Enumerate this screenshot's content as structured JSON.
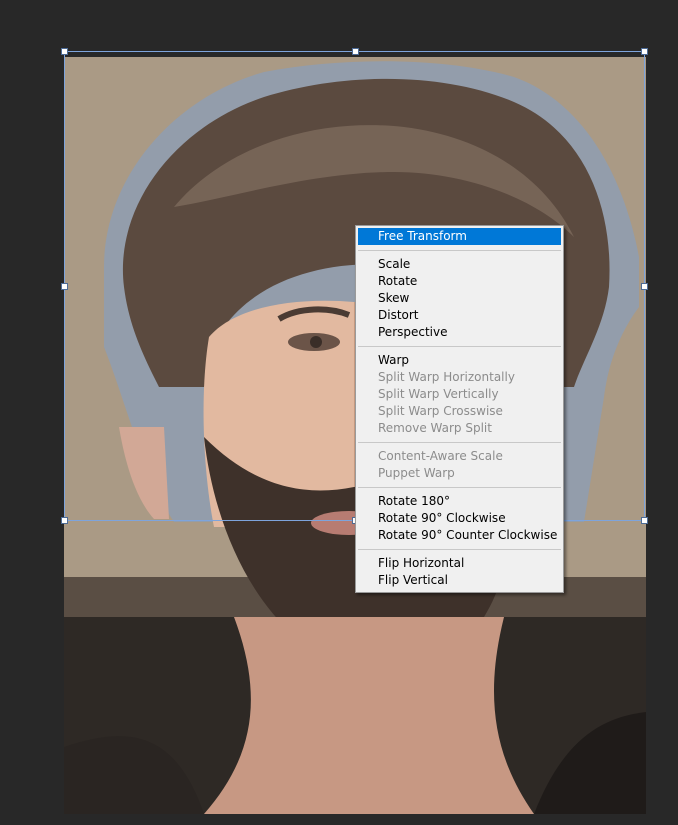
{
  "canvas": {
    "image_subject": "bearded-man-portrait-photo"
  },
  "transform_box": {
    "handle_color": "#ffffff",
    "border_color": "#7ea4dc"
  },
  "context_menu": {
    "highlight_color": "#0078d7",
    "groups": [
      [
        {
          "label": "Free Transform",
          "state": "highlighted"
        }
      ],
      [
        {
          "label": "Scale",
          "state": "enabled"
        },
        {
          "label": "Rotate",
          "state": "enabled"
        },
        {
          "label": "Skew",
          "state": "enabled"
        },
        {
          "label": "Distort",
          "state": "enabled"
        },
        {
          "label": "Perspective",
          "state": "enabled"
        }
      ],
      [
        {
          "label": "Warp",
          "state": "enabled"
        },
        {
          "label": "Split Warp Horizontally",
          "state": "disabled"
        },
        {
          "label": "Split Warp Vertically",
          "state": "disabled"
        },
        {
          "label": "Split Warp Crosswise",
          "state": "disabled"
        },
        {
          "label": "Remove Warp Split",
          "state": "disabled"
        }
      ],
      [
        {
          "label": "Content-Aware Scale",
          "state": "disabled"
        },
        {
          "label": "Puppet Warp",
          "state": "disabled"
        }
      ],
      [
        {
          "label": "Rotate 180°",
          "state": "enabled"
        },
        {
          "label": "Rotate 90° Clockwise",
          "state": "enabled"
        },
        {
          "label": "Rotate 90° Counter Clockwise",
          "state": "enabled"
        }
      ],
      [
        {
          "label": "Flip Horizontal",
          "state": "enabled"
        },
        {
          "label": "Flip Vertical",
          "state": "enabled"
        }
      ]
    ]
  }
}
